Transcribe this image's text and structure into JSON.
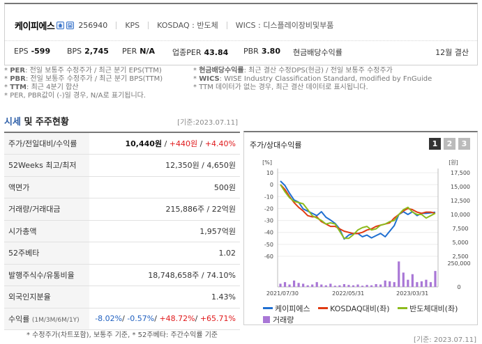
{
  "header": {
    "company_name": "케이피에스",
    "code": "256940",
    "meta": [
      "KPS",
      "KOSDAQ : 반도체",
      "WICS : 디스플레이장비및부품"
    ],
    "metrics": [
      {
        "label": "EPS",
        "value": "-599"
      },
      {
        "label": "BPS",
        "value": "2,745"
      },
      {
        "label": "PER",
        "value": "N/A"
      },
      {
        "label": "업종PER",
        "value": "43.84"
      },
      {
        "label": "PBR",
        "value": "3.80"
      },
      {
        "label": "현금배당수익률",
        "value": ""
      }
    ],
    "settle": "12월 결산"
  },
  "notes": {
    "left": [
      {
        "key": "PER",
        "text": ": 전일 보통주 수정주가 / 최근 분기 EPS(TTM)"
      },
      {
        "key": "PBR",
        "text": ": 전일 보통주 수정주가 / 최근 분기 BPS(TTM)"
      },
      {
        "key": "TTM",
        "text": ": 최근 4분기 합산"
      },
      {
        "key": "",
        "text": "PER, PBR값이 (-)일 경우, N/A로 표기됩니다."
      }
    ],
    "right": [
      {
        "key": "현금배당수익률",
        "text": ": 최근 결산 수정DPS(현금) / 전일 보통주 수정주가"
      },
      {
        "key": "WICS",
        "text": ": WISE Industry Classification Standard, modified by FnGuide"
      },
      {
        "key": "",
        "text": "TTM 데이터가 없는 경우, 최근 결산 데이터로 표시됩니다."
      }
    ]
  },
  "section": {
    "title_hl": "시세",
    "title_rest": " 및 주주현황",
    "base_date": "[기준:2023.07.11]"
  },
  "table": {
    "rows": [
      {
        "label": "주가/전일대비/수익률",
        "value": "",
        "parts": [
          "10,440원",
          " / ",
          "+440원",
          " / ",
          "+4.40%"
        ]
      },
      {
        "label": "52Weeks 최고/최저",
        "value": "12,350원 / 4,650원"
      },
      {
        "label": "액면가",
        "value": "500원"
      },
      {
        "label": "거래량/거래대금",
        "value": "215,886주 / 22억원"
      },
      {
        "label": "시가총액",
        "value": "1,957억원"
      },
      {
        "label": "52주베타",
        "value": "1.02"
      },
      {
        "label": "발행주식수/유통비율",
        "value": "18,748,658주 / 74.10%"
      },
      {
        "label": "외국인지분율",
        "value": "1.43%"
      }
    ],
    "returns_label": "수익률",
    "returns_sub": "(1M/3M/6M/1Y)",
    "returns": [
      "-8.02%",
      "-0.57%",
      "+48.72%",
      "+65.71%"
    ]
  },
  "footnote": "* 수정주가(차트포함), 보통주 기준, * 52주베타: 주간수익률 기준",
  "base_date_bottom": "[기준: 2023.07.11]",
  "chart": {
    "title": "주가/상대수익률",
    "pages": [
      "1",
      "2",
      "3"
    ],
    "legend": [
      {
        "name": "케이피에스",
        "color": "#1f6fd1",
        "kind": "line"
      },
      {
        "name": "KOSDAQ대비(좌)",
        "color": "#e03a12",
        "kind": "line"
      },
      {
        "name": "반도체대비(좌)",
        "color": "#8dbb1d",
        "kind": "line"
      },
      {
        "name": "거래량",
        "color": "#a977d6",
        "kind": "box"
      }
    ]
  },
  "chart_data": {
    "type": "line",
    "left_unit": "[%]",
    "right_unit": "[원]",
    "left_ticks": [
      "10",
      "0",
      "-10",
      "-20",
      "-30",
      "-40",
      "-50",
      "-60"
    ],
    "right_ticks": [
      "17,500",
      "15,000",
      "12,500",
      "10,000",
      "7,500",
      "5,000",
      "2,500"
    ],
    "vol_ticks": [
      "250,000",
      "0"
    ],
    "x_ticks": [
      "2021/07/30",
      "2022/05/31",
      "2023/03/31"
    ],
    "ylim": [
      -60,
      10
    ],
    "y2lim": [
      2500,
      17500
    ],
    "series": [
      {
        "name": "케이피에스",
        "axis": "right",
        "values": [
          16000,
          15200,
          13800,
          12600,
          12200,
          11000,
          10600,
          10200,
          9800,
          10500,
          9500,
          9000,
          8400,
          7400,
          5600,
          6300,
          6600,
          6600,
          6000,
          6300,
          5800,
          6200,
          6600,
          6000,
          7000,
          8000,
          10000,
          10500,
          10000,
          10500,
          9800,
          10200,
          10200,
          10300,
          10400
        ]
      },
      {
        "name": "KOSDAQ대비(좌)",
        "axis": "left",
        "values": [
          0,
          -4,
          -10,
          -15,
          -19,
          -22,
          -26,
          -27,
          -27,
          -31,
          -33,
          -35,
          -35,
          -37,
          -39,
          -40,
          -41,
          -41,
          -40,
          -38,
          -37,
          -35,
          -34,
          -33,
          -32,
          -28,
          -25,
          -22,
          -20,
          -21,
          -23,
          -24,
          -23,
          -23,
          -24
        ]
      },
      {
        "name": "반도체대비(좌)",
        "axis": "left",
        "values": [
          0,
          -6,
          -11,
          -14,
          -15,
          -16,
          -21,
          -26,
          -28,
          -30,
          -33,
          -32,
          -33,
          -39,
          -45,
          -45,
          -42,
          -38,
          -36,
          -35,
          -38,
          -37,
          -34,
          -33,
          -31,
          -30,
          -25,
          -21,
          -19,
          -23,
          -25,
          -25,
          -28,
          -26,
          -24
        ]
      },
      {
        "name": "거래량",
        "axis": "vol",
        "values": [
          40000,
          60000,
          30000,
          80000,
          50000,
          40000,
          20000,
          30000,
          60000,
          30000,
          20000,
          40000,
          15000,
          20000,
          35000,
          25000,
          20000,
          30000,
          15000,
          25000,
          20000,
          35000,
          30000,
          80000,
          70000,
          60000,
          320000,
          180000,
          90000,
          160000,
          60000,
          70000,
          90000,
          60000,
          200000
        ]
      }
    ]
  }
}
